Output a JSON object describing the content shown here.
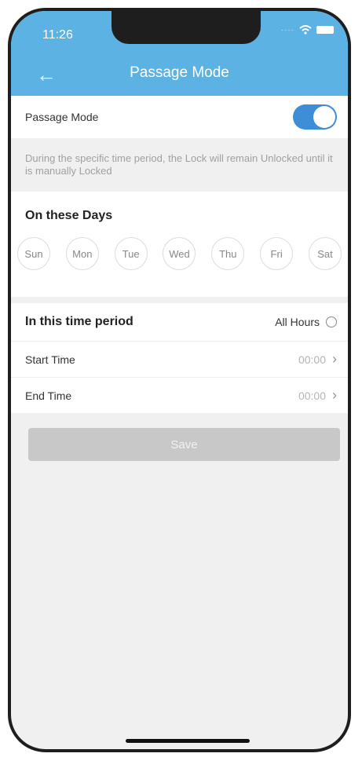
{
  "status_bar": {
    "time": "11:26"
  },
  "nav": {
    "title": "Passage Mode"
  },
  "passage_mode": {
    "label": "Passage Mode",
    "enabled": true
  },
  "description": "During the specific time period, the Lock will remain Unlocked until it is manually Locked",
  "days": {
    "title": "On these Days",
    "items": [
      "Sun",
      "Mon",
      "Tue",
      "Wed",
      "Thu",
      "Fri",
      "Sat"
    ]
  },
  "period": {
    "title": "In this time period",
    "all_hours_label": "All Hours",
    "start_label": "Start Time",
    "start_value": "00:00",
    "end_label": "End Time",
    "end_value": "00:00"
  },
  "save_label": "Save",
  "colors": {
    "header": "#5db2e4",
    "toggle_on": "#3d8dd7",
    "save_disabled": "#c8c8c8"
  },
  "icons": {
    "back": "arrow-left-icon",
    "wifi": "wifi-icon",
    "battery": "battery-icon",
    "chevron": "chevron-right-icon",
    "radio": "radio-unchecked-icon"
  }
}
